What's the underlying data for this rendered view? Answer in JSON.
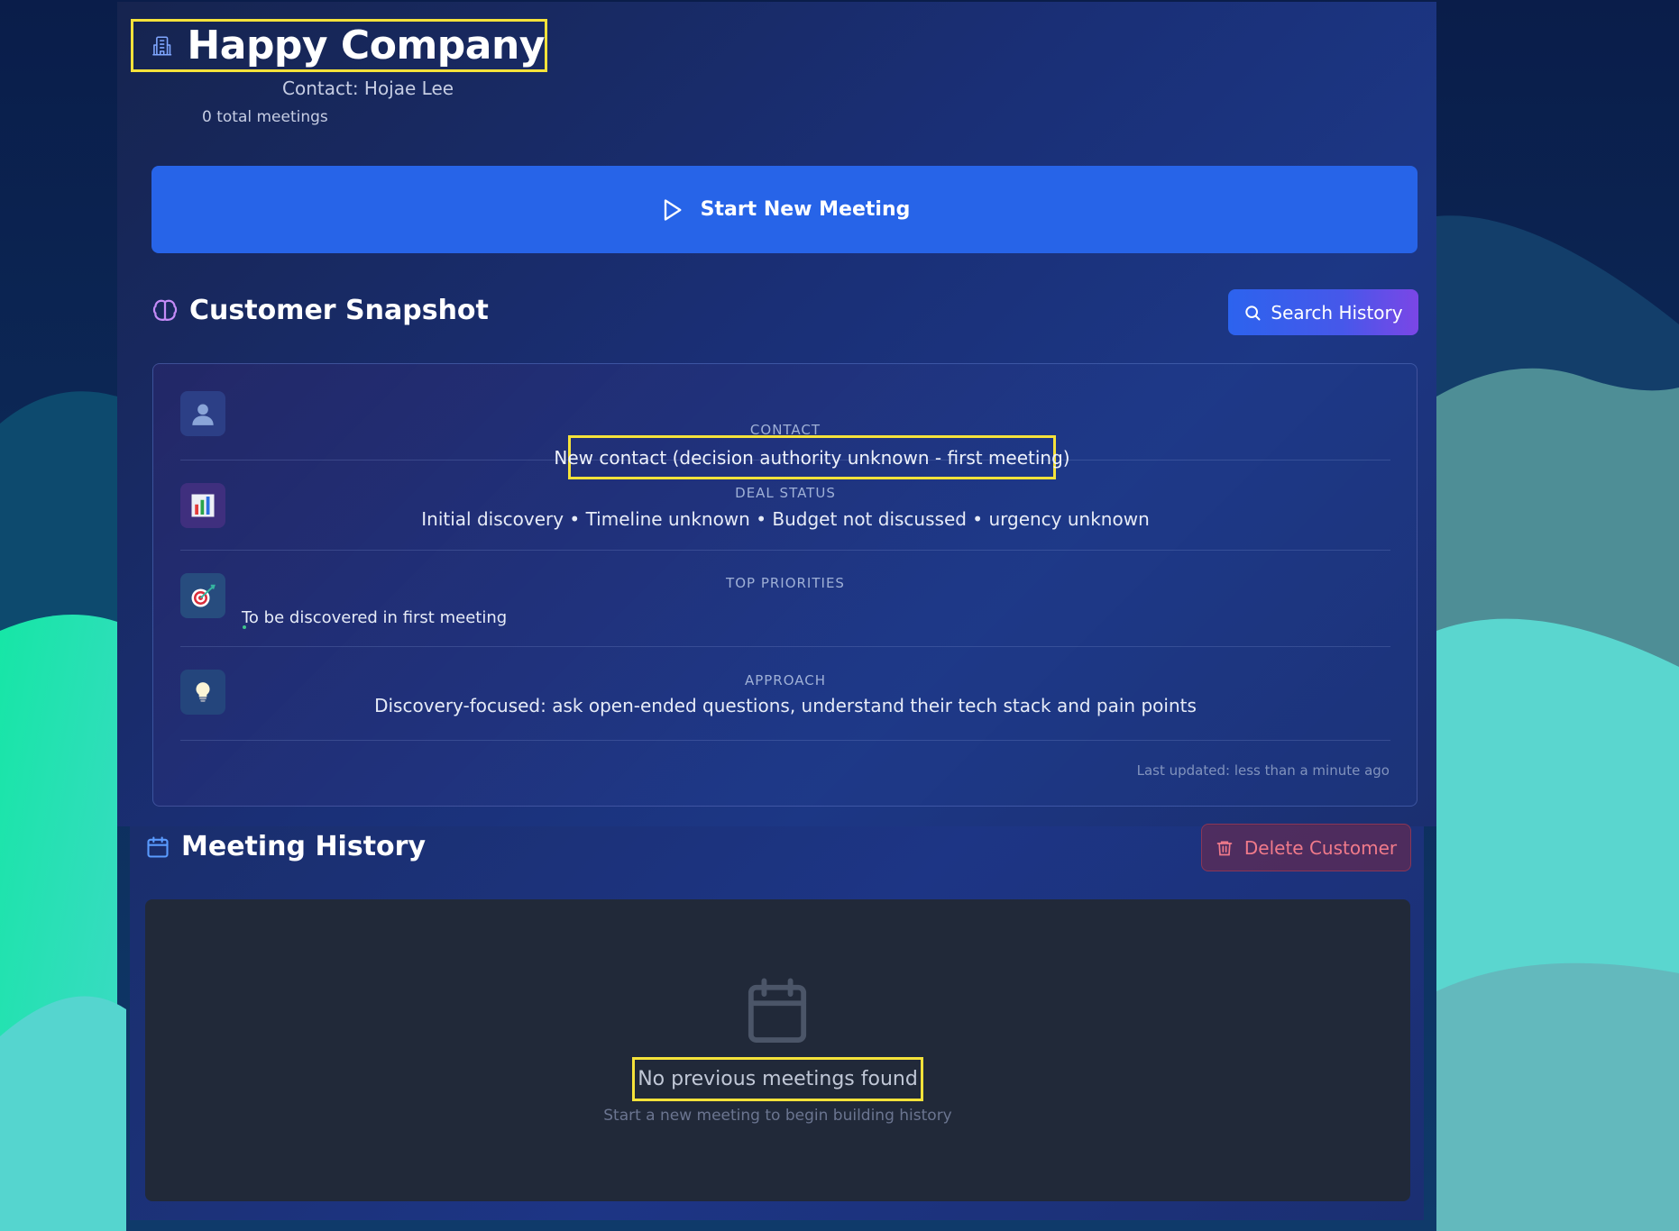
{
  "header": {
    "company_name": "Happy Company",
    "contact": "Contact: Hojae Lee",
    "meetings_count": "0 total meetings"
  },
  "actions": {
    "start_meeting_label": "Start New Meeting",
    "search_history_label": "Search History",
    "delete_customer_label": "Delete Customer"
  },
  "snapshot": {
    "title": "Customer Snapshot",
    "rows": [
      {
        "label": "CONTACT",
        "value": "New contact (decision authority unknown - first meeting)",
        "icon": "person-icon"
      },
      {
        "label": "DEAL STATUS",
        "value": "Initial discovery • Timeline unknown • Budget not discussed • urgency unknown",
        "icon": "bar-chart-icon"
      },
      {
        "label": "TOP PRIORITIES",
        "value": "To be discovered in first meeting",
        "icon": "target-icon"
      },
      {
        "label": "APPROACH",
        "value": "Discovery-focused: ask open-ended questions, understand their tech stack and pain points",
        "icon": "lightbulb-icon"
      }
    ],
    "last_updated": "Last updated: less than a minute ago"
  },
  "history": {
    "title": "Meeting History",
    "empty_title": "No previous meetings found",
    "empty_subtitle": "Start a new meeting to begin building history"
  },
  "colors": {
    "primary_button": "#2764e8",
    "danger_text": "#f07a8a",
    "highlight_outline": "#f5e23a",
    "accent_purple": "#7b46e6"
  }
}
